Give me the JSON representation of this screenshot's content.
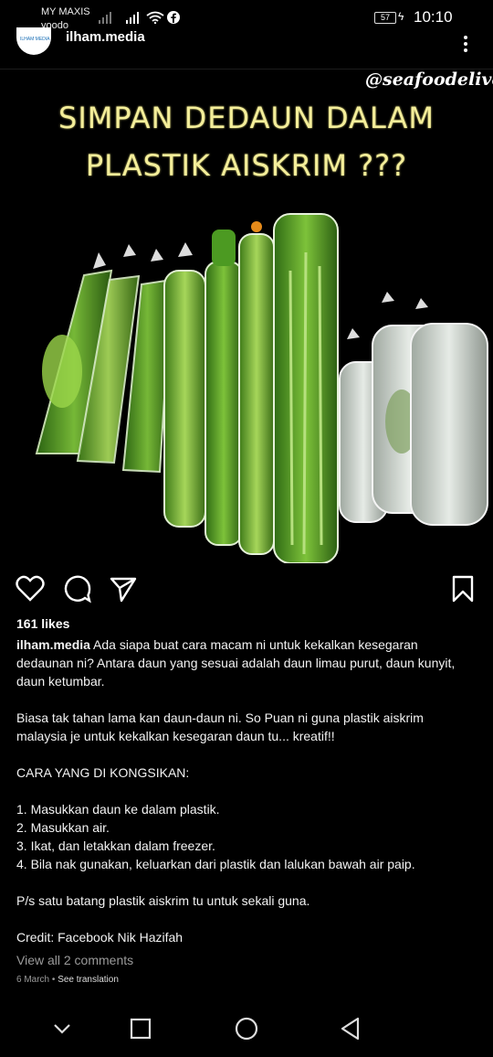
{
  "status_bar": {
    "carrier": "MY MAXIS",
    "carrier2": "yoodo",
    "battery": "57",
    "time": "10:10"
  },
  "post": {
    "username": "ilham.media",
    "image": {
      "watermark": "@seafoodelivery",
      "headline_line1": "SIMPAN DEDAUN DALAM",
      "headline_line2": "PLASTIK AISKRIM ???"
    },
    "likes": "161 likes",
    "caption": {
      "username": "ilham.media",
      "p1": "Ada siapa buat cara macam ni untuk kekalkan kesegaran dedaunan ni? Antara daun yang sesuai adalah daun limau purut, daun kunyit, daun ketumbar.",
      "p2": "Biasa tak tahan lama kan daun-daun ni. So Puan ni guna plastik aiskrim malaysia je untuk kekalkan kesegaran daun tu... kreatif!!",
      "p3": "CARA YANG DI KONGSIKAN:",
      "steps": [
        "1. Masukkan daun ke dalam plastik.",
        "2. Masukkan air.",
        "3. Ikat, dan letakkan dalam freezer.",
        "4. Bila nak gunakan, keluarkan dari plastik dan lalukan bawah air paip."
      ],
      "p4": "P/s satu batang plastik aiskrim tu untuk sekali guna.",
      "p5": "Credit: Facebook Nik Hazifah"
    },
    "view_comments": "View all 2 comments",
    "date": "6 March",
    "translate": "See translation"
  },
  "colors": {
    "background": "#000000",
    "headline": "#f4ee9a",
    "muted": "#9a9a9a"
  },
  "icons": [
    "signal-icon",
    "wifi-icon",
    "facebook-icon",
    "more-icon",
    "heart-icon",
    "comment-icon",
    "share-icon",
    "bookmark-icon",
    "back-nav-icon",
    "home-nav-icon",
    "recents-nav-icon",
    "collapse-nav-icon"
  ]
}
